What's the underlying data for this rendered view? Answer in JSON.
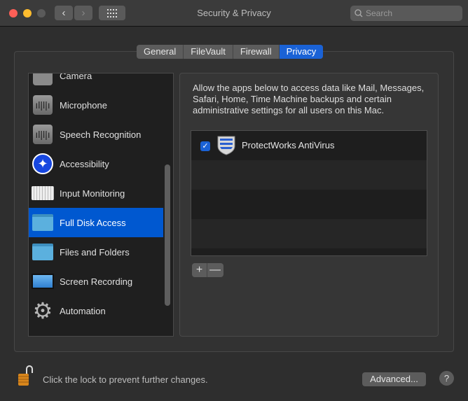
{
  "window": {
    "title": "Security & Privacy",
    "search_placeholder": "Search"
  },
  "tabs": [
    {
      "label": "General"
    },
    {
      "label": "FileVault"
    },
    {
      "label": "Firewall"
    },
    {
      "label": "Privacy",
      "active": true
    }
  ],
  "sidebar": {
    "items": [
      {
        "label": "Camera",
        "icon": "camera-icon"
      },
      {
        "label": "Microphone",
        "icon": "microphone-icon"
      },
      {
        "label": "Speech Recognition",
        "icon": "speech-recognition-icon"
      },
      {
        "label": "Accessibility",
        "icon": "accessibility-icon"
      },
      {
        "label": "Input Monitoring",
        "icon": "keyboard-icon"
      },
      {
        "label": "Full Disk Access",
        "icon": "folder-icon",
        "selected": true
      },
      {
        "label": "Files and Folders",
        "icon": "folder-icon"
      },
      {
        "label": "Screen Recording",
        "icon": "display-icon"
      },
      {
        "label": "Automation",
        "icon": "gear-icon"
      }
    ]
  },
  "main": {
    "description": "Allow the apps below to access data like Mail, Messages, Safari, Home, Time Machine backups and certain administrative settings for all users on this Mac.",
    "apps": [
      {
        "name": "ProtectWorks AntiVirus",
        "checked": true,
        "icon": "shield-icon"
      }
    ],
    "add_label": "+",
    "remove_label": "—"
  },
  "footer": {
    "lock_text": "Click the lock to prevent further changes.",
    "advanced_label": "Advanced...",
    "help_label": "?"
  },
  "colors": {
    "accent": "#0058d0",
    "tab_active": "#1a62d6"
  }
}
